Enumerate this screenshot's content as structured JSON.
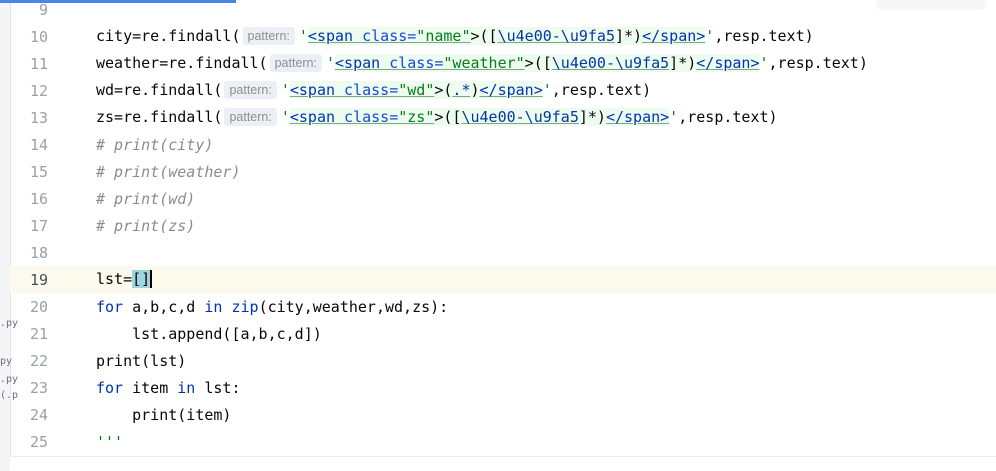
{
  "left_strip": {
    "frags": [
      ".py",
      "py",
      ".py",
      "(.p"
    ]
  },
  "lines": [
    {
      "num": "9",
      "code": ""
    },
    {
      "num": "10"
    },
    {
      "num": "11"
    },
    {
      "num": "12"
    },
    {
      "num": "13"
    },
    {
      "num": "14",
      "code": "# print(city)"
    },
    {
      "num": "15",
      "code": "# print(weather)"
    },
    {
      "num": "16",
      "code": "# print(wd)"
    },
    {
      "num": "17",
      "code": "# print(zs)"
    },
    {
      "num": "18",
      "code": ""
    },
    {
      "num": "19"
    },
    {
      "num": "20"
    },
    {
      "num": "21"
    },
    {
      "num": "22"
    },
    {
      "num": "23"
    },
    {
      "num": "24"
    },
    {
      "num": "25",
      "code": "'''"
    }
  ],
  "line10": {
    "pre": "city=re.findall(",
    "hint": "pattern:",
    "q1": "'",
    "tag_open": "<span",
    "attr": " class=",
    "val": "\"name\"",
    "gt": ">(",
    "br1": "[",
    "esc": "\\u4e00-\\u9fa5",
    "br2": "]*)",
    "tag_close": "</span>",
    "q2": "'",
    "post": ",resp.text)"
  },
  "line11": {
    "pre": "weather=re.findall(",
    "hint": "pattern:",
    "q1": "'",
    "tag_open": "<span",
    "attr": " class=",
    "val": "\"weather\"",
    "gt": ">(",
    "br1": "[",
    "esc": "\\u4e00-\\u9fa5",
    "br2": "]*)",
    "tag_close": "</span>",
    "q2": "'",
    "post": ",resp.text)"
  },
  "line12": {
    "pre": "wd=re.findall(",
    "hint": "pattern:",
    "q1": "'",
    "tag_open": "<span",
    "attr": " class=",
    "val": "\"wd\"",
    "gt": ">(",
    "mid": ".*",
    "br2": ")",
    "tag_close": "</span>",
    "q2": "'",
    "post": ",resp.text)"
  },
  "line13": {
    "pre": "zs=re.findall(",
    "hint": "pattern:",
    "q1": "'",
    "tag_open": "<span",
    "attr": " class=",
    "val": "\"zs\"",
    "gt": ">(",
    "br1": "[",
    "esc": "\\u4e00-\\u9fa5",
    "br2": "]*)",
    "tag_close": "</span>",
    "q2": "'",
    "post": ",resp.text)"
  },
  "line19": {
    "pre": "lst=",
    "sel": "[]"
  },
  "line20": {
    "kw1": "for",
    "mid1": " a,b,c,d ",
    "kw2": "in",
    "sp": " ",
    "kw3": "zip",
    "post": "(city,weather,wd,zs):"
  },
  "line21": {
    "code": "    lst.append([a,b,c,d])"
  },
  "line22": {
    "code": "print(lst)"
  },
  "line23": {
    "kw1": "for",
    "mid": " item ",
    "kw2": "in",
    "post": " lst:"
  },
  "line24": {
    "code": "    print(item)"
  }
}
